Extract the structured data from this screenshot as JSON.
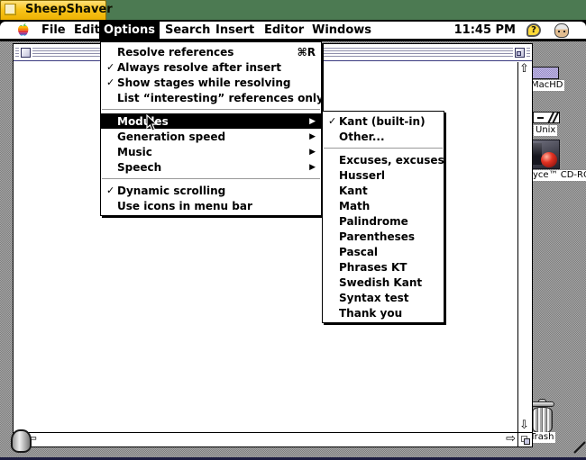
{
  "frame": {
    "title": "SheepShaver",
    "tab_color": "#f9c41c",
    "strip_color": "#4c7a52"
  },
  "menubar": {
    "items": [
      {
        "label": "File"
      },
      {
        "label": "Edit"
      },
      {
        "label": "Options"
      },
      {
        "label": "Search"
      },
      {
        "label": "Insert"
      },
      {
        "label": "Editor"
      },
      {
        "label": "Windows"
      }
    ],
    "active_menu": "Options",
    "clock": "11:45 PM",
    "help_glyph": "?"
  },
  "options_menu": {
    "items": [
      {
        "mark": "",
        "label": "Resolve references",
        "shortcut": "⌘R"
      },
      {
        "mark": "✓",
        "label": "Always resolve after insert"
      },
      {
        "mark": "✓",
        "label": "Show stages while resolving"
      },
      {
        "mark": "",
        "label": "List “interesting” references only"
      },
      {
        "type": "separator"
      },
      {
        "mark": "",
        "label": "Modules",
        "arrow": "▶",
        "highlighted": true
      },
      {
        "mark": "",
        "label": "Generation speed",
        "arrow": "▶"
      },
      {
        "mark": "",
        "label": "Music",
        "arrow": "▶"
      },
      {
        "mark": "",
        "label": "Speech",
        "arrow": "▶"
      },
      {
        "type": "separator"
      },
      {
        "mark": "✓",
        "label": "Dynamic scrolling"
      },
      {
        "mark": "",
        "label": "Use icons in menu bar"
      }
    ]
  },
  "modules_submenu": {
    "items": [
      {
        "mark": "✓",
        "label": "Kant (built-in)"
      },
      {
        "mark": "",
        "label": "Other..."
      },
      {
        "type": "separator"
      },
      {
        "mark": "",
        "label": "Excuses, excuses"
      },
      {
        "mark": "",
        "label": "Husserl"
      },
      {
        "mark": "",
        "label": "Kant"
      },
      {
        "mark": "",
        "label": "Math"
      },
      {
        "mark": "",
        "label": "Palindrome"
      },
      {
        "mark": "",
        "label": "Parentheses"
      },
      {
        "mark": "",
        "label": "Pascal"
      },
      {
        "mark": "",
        "label": "Phrases KT"
      },
      {
        "mark": "",
        "label": "Swedish Kant"
      },
      {
        "mark": "",
        "label": "Syntax test"
      },
      {
        "mark": "",
        "label": "Thank you"
      }
    ]
  },
  "desktop": {
    "icons": [
      {
        "label": "MacHD"
      },
      {
        "label": "Unix"
      },
      {
        "label": "yce™ CD-RO"
      },
      {
        "label": "Trash"
      }
    ]
  },
  "glyphs": {
    "scroll_up": "⇧",
    "scroll_down": "⇩",
    "scroll_left": "⇦",
    "scroll_right": "⇨"
  }
}
